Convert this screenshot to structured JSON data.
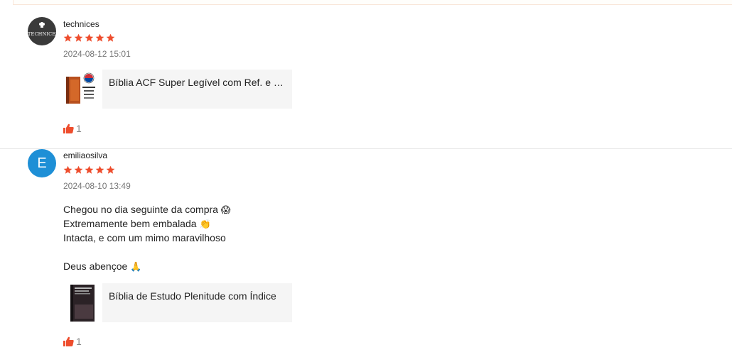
{
  "colors": {
    "star": "#ee4d2d",
    "accent": "#ee4d2d",
    "avatar_blue": "#1e8fd6"
  },
  "reviews": [
    {
      "username": "technices",
      "avatar": {
        "type": "logo",
        "text": "TECHNICES",
        "icon": "chef-hat-icon"
      },
      "rating": 5,
      "timestamp": "2024-08-12 15:01",
      "comment_lines": [],
      "product": {
        "name": "Bíblia ACF Super Legível com Ref. e M...",
        "thumbnail_icon": "bible-book-orange-icon"
      },
      "likes": "1"
    },
    {
      "username": "emiliaosilva",
      "avatar": {
        "type": "letter",
        "letter": "E"
      },
      "rating": 5,
      "timestamp": "2024-08-10 13:49",
      "comment_lines": [
        {
          "text": "Chegou no dia seguinte da compra ",
          "emoji": "😱"
        },
        {
          "text": "Extremamente bem embalada ",
          "emoji": "👏"
        },
        {
          "text": "Intacta, e com um mimo maravilhoso",
          "emoji": ""
        },
        {
          "text": "",
          "emoji": ""
        },
        {
          "text": "Deus abençoe ",
          "emoji": "🙏"
        }
      ],
      "product": {
        "name": "Bíblia de Estudo Plenitude com Índice",
        "thumbnail_icon": "bible-book-dark-icon"
      },
      "likes": "1"
    }
  ]
}
